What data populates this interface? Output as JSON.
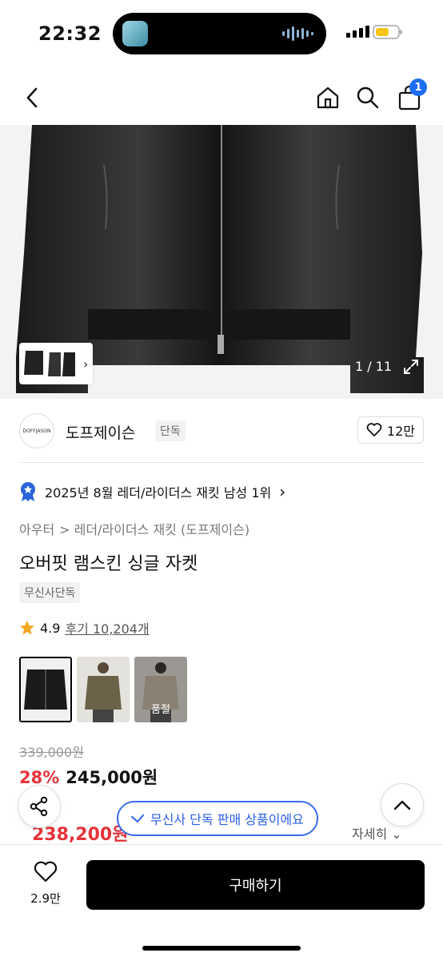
{
  "status_bar": {
    "time": "22:32"
  },
  "nav": {
    "cart_count": "1"
  },
  "gallery": {
    "counter": "1 / 11"
  },
  "brand": {
    "logo_text": "DOFFJASON",
    "name": "도프제이슨",
    "exclusive_tag": "단독",
    "likes": "12만"
  },
  "ranking": {
    "text": "2025년 8월 레더/라이더스 재킷 남성 1위"
  },
  "breadcrumb": {
    "category": "아우터",
    "sub": "> 레더/라이더스 재킷 (도프제이슨)"
  },
  "product": {
    "title": "오버핏 램스킨 싱글 자켓",
    "tag": "무신사단독"
  },
  "rating": {
    "score": "4.9",
    "reviews": "후기 10,204개"
  },
  "variants": [
    {
      "name": "black",
      "soldout": ""
    },
    {
      "name": "khaki",
      "soldout": ""
    },
    {
      "name": "beige",
      "soldout": "품절"
    }
  ],
  "price": {
    "original": "339,000원",
    "discount": "28%",
    "sale": "245,000원",
    "benefit": "238,200원",
    "detail": "자세히"
  },
  "toast": {
    "text": "무신사 단독 판매 상품이에요"
  },
  "bottom": {
    "wish_count": "2.9만",
    "buy_label": "구매하기"
  },
  "colors": {
    "accent_blue": "#1e6ef4",
    "sale_red": "#e5333a"
  }
}
